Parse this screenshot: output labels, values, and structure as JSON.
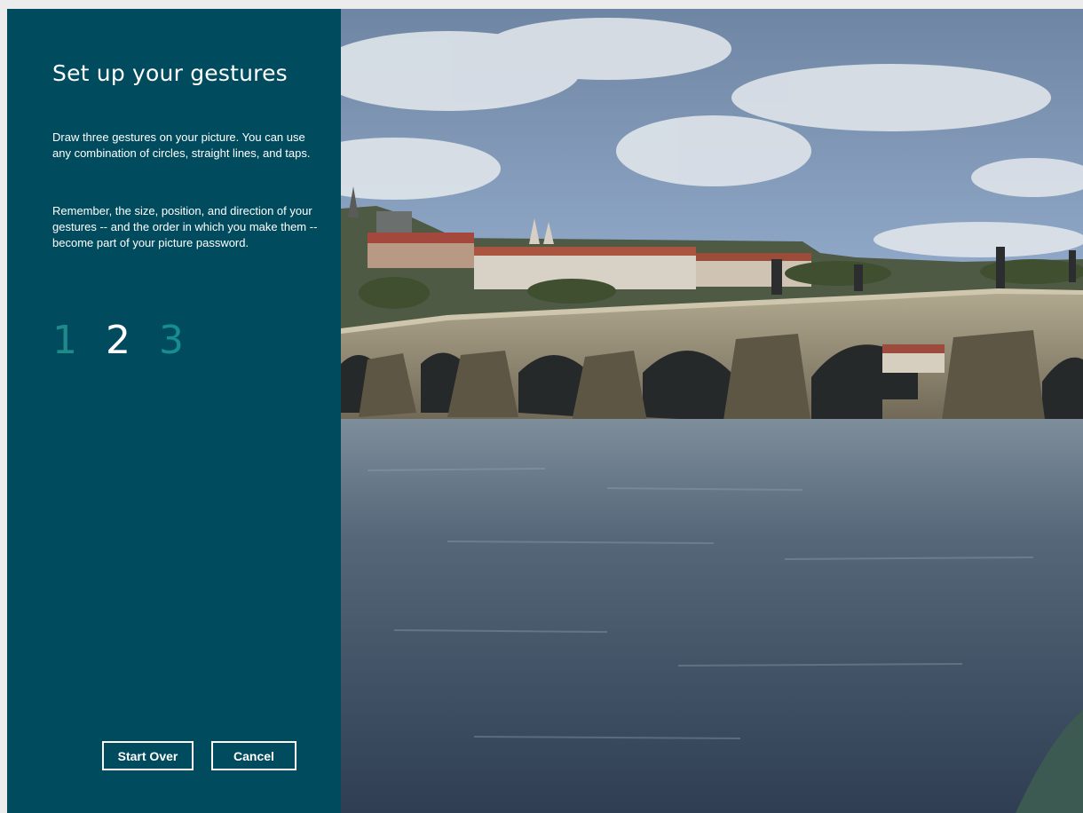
{
  "panel": {
    "title": "Set up your gestures",
    "instructions": "Draw three gestures on your picture. You can use any combination of circles, straight lines, and taps.",
    "reminder": "Remember, the size, position, and direction of your gestures -- and the order in which you make them -- become part of your picture password.",
    "steps": [
      {
        "label": "1",
        "state": "done"
      },
      {
        "label": "2",
        "state": "current"
      },
      {
        "label": "3",
        "state": "pending"
      }
    ],
    "buttons": {
      "start_over": "Start Over",
      "cancel": "Cancel"
    }
  },
  "colors": {
    "panel_bg": "#004b5d",
    "step_done": "#1f8a8a",
    "step_current": "#ffffff",
    "step_pending": "#168e90"
  }
}
